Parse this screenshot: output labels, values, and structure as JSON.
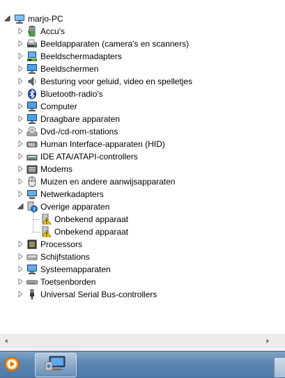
{
  "tree": {
    "root": {
      "label": "marjo-PC",
      "icon": "computer-icon"
    },
    "items": [
      {
        "name": "accus",
        "label": "Accu's",
        "icon": "battery-icon",
        "expanded": false
      },
      {
        "name": "beeldapparaten",
        "label": "Beeldapparaten (camera's en scanners)",
        "icon": "scanner-icon",
        "expanded": false
      },
      {
        "name": "beeldschermadapters",
        "label": "Beeldschermadapters",
        "icon": "display-adapter-icon",
        "expanded": false
      },
      {
        "name": "beeldschermen",
        "label": "Beeldschermen",
        "icon": "monitor-icon",
        "expanded": false
      },
      {
        "name": "besturing",
        "label": "Besturing voor geluid, video en spelletjes",
        "icon": "speaker-icon",
        "expanded": false
      },
      {
        "name": "bluetooth",
        "label": "Bluetooth-radio's",
        "icon": "bluetooth-icon",
        "expanded": false
      },
      {
        "name": "computer",
        "label": "Computer",
        "icon": "monitor-icon",
        "expanded": false
      },
      {
        "name": "draagbare",
        "label": "Draagbare apparaten",
        "icon": "monitor-icon",
        "expanded": false
      },
      {
        "name": "dvd",
        "label": "Dvd-/cd-rom-stations",
        "icon": "disc-drive-icon",
        "expanded": false
      },
      {
        "name": "hid",
        "label": "Human Interface-apparaten (HID)",
        "icon": "hid-icon",
        "expanded": false
      },
      {
        "name": "ide",
        "label": "IDE ATA/ATAPI-controllers",
        "icon": "ide-controller-icon",
        "expanded": false
      },
      {
        "name": "modems",
        "label": "Modems",
        "icon": "modem-icon",
        "expanded": false
      },
      {
        "name": "muizen",
        "label": "Muizen en andere aanwijsapparaten",
        "icon": "mouse-icon",
        "expanded": false
      },
      {
        "name": "netwerkadapters",
        "label": "Netwerkadapters",
        "icon": "network-adapter-icon",
        "expanded": false
      },
      {
        "name": "overige",
        "label": "Overige apparaten",
        "icon": "unknown-device-icon",
        "expanded": true,
        "children": [
          {
            "name": "onbekend-1",
            "label": "Onbekend apparaat",
            "icon": "warning-device-icon"
          },
          {
            "name": "onbekend-2",
            "label": "Onbekend apparaat",
            "icon": "warning-device-icon"
          }
        ]
      },
      {
        "name": "processors",
        "label": "Processors",
        "icon": "processor-icon",
        "expanded": false
      },
      {
        "name": "schijfstations",
        "label": "Schijfstations",
        "icon": "disk-drive-icon",
        "expanded": false
      },
      {
        "name": "systeemapparaten",
        "label": "Systeemapparaten",
        "icon": "system-device-icon",
        "expanded": false
      },
      {
        "name": "toetsenborden",
        "label": "Toetsenborden",
        "icon": "keyboard-icon",
        "expanded": false
      },
      {
        "name": "usb",
        "label": "Universal Serial Bus-controllers",
        "icon": "usb-icon",
        "expanded": false
      }
    ]
  },
  "taskbar": {
    "buttons": [
      {
        "name": "media-player",
        "icon": "media-player-icon"
      },
      {
        "name": "device-manager",
        "icon": "device-manager-icon",
        "active": true
      }
    ]
  },
  "colors": {
    "accent": "#1f6fc5",
    "taskbar": "#5d87b2",
    "warning": "#f5c400"
  }
}
